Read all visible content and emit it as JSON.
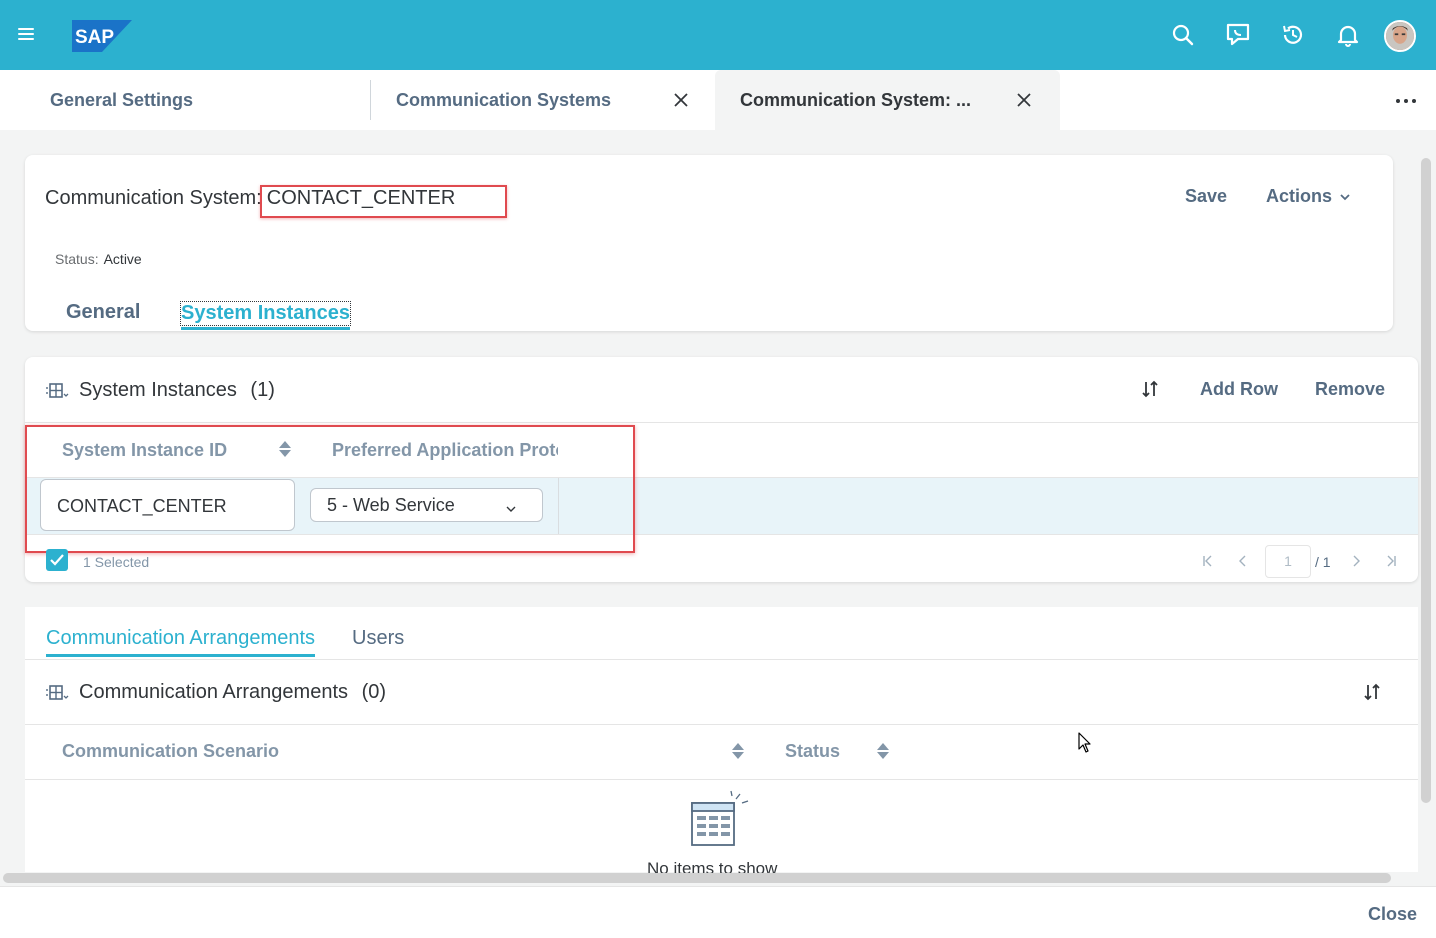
{
  "shell": {
    "logo_text": "SAP",
    "icons": [
      "menu-icon",
      "search-icon",
      "feedback-icon",
      "history-icon",
      "notification-icon"
    ],
    "brand_color": "#2cb1cf"
  },
  "tabs": [
    {
      "label": "General Settings"
    },
    {
      "label": "Communication Systems"
    },
    {
      "label": "Communication System: ..."
    }
  ],
  "header": {
    "title_prefix": "Communication System:",
    "title_value": "CONTACT_CENTER",
    "save_label": "Save",
    "actions_label": "Actions",
    "status_label": "Status:",
    "status_value": "Active",
    "sections": [
      "General",
      "System Instances"
    ],
    "active_section": "System Instances"
  },
  "system_instances": {
    "title": "System Instances",
    "count": "(1)",
    "add_row_label": "Add Row",
    "remove_label": "Remove",
    "columns": [
      "System Instance ID",
      "Preferred Application Proto"
    ],
    "rows": [
      {
        "instance_id": "CONTACT_CENTER",
        "protocol": "5 - Web Service"
      }
    ],
    "selected_text": "1 Selected",
    "pager": {
      "page": "1",
      "total": "/ 1"
    }
  },
  "arrangements": {
    "tabs": [
      "Communication Arrangements",
      "Users"
    ],
    "active_tab": "Communication Arrangements",
    "title": "Communication Arrangements",
    "count": "(0)",
    "columns": [
      "Communication Scenario",
      "Status"
    ],
    "empty_text": "No items to show"
  },
  "footer": {
    "close_label": "Close"
  }
}
